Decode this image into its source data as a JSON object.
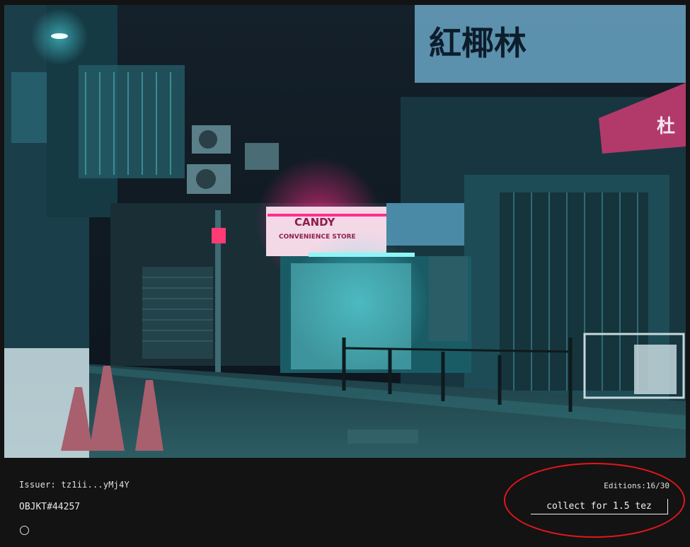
{
  "artwork": {
    "description_icon": "artwork-image",
    "sign_main": "紅椰林",
    "sign_shop": "CANDY",
    "sign_store": "CONVENIENCE STORE",
    "sign_red": "杜"
  },
  "token": {
    "issuer_label": "Issuer:",
    "issuer_value": "tz1ii...yMj4Y",
    "objkt_id": "OBJKT#44257",
    "editions": "Editions:16/30",
    "collect_label": "collect for 1.5 tez"
  },
  "colors": {
    "background": "#131313",
    "text": "#e8e8e8",
    "highlight": "#e3161b"
  }
}
